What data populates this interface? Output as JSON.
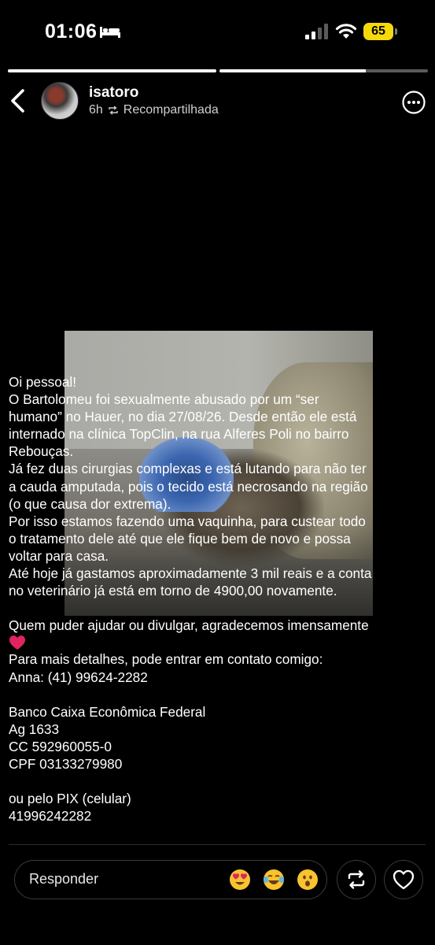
{
  "status_bar": {
    "time": "01:06",
    "battery_level": "65",
    "icons": [
      "bed-icon",
      "signal-icon",
      "wifi-icon",
      "battery-icon"
    ]
  },
  "progress": [
    {
      "fill": 1.0
    },
    {
      "fill": 0.7
    }
  ],
  "story": {
    "username": "isatoro",
    "age": "6h",
    "repost_label": "Recompartilhada",
    "text_lines": [
      "Oi pessoal!",
      "O Bartolomeu foi sexualmente abusado por um “ser",
      "humano” no Hauer, no dia 27/08/26. Desde então ele está",
      "internado na clínica TopClin, na rua Alferes Poli no bairro",
      "Rebouças.",
      "Já fez duas cirurgias complexas e está lutando para não ter",
      "a cauda amputada, pois o tecido está necrosando na região",
      "(o que causa dor extrema).",
      "Por isso estamos fazendo uma vaquinha, para custear todo",
      "o tratamento dele até que ele fique bem de novo e possa",
      "voltar para casa.",
      "Até hoje já gastamos aproximadamente 3 mil reais e a conta",
      "no veterinário já está em torno de 4900,00 novamente."
    ],
    "text_lines_2": [
      "Quem puder ajudar ou divulgar, agradecemos imensamente"
    ],
    "text_lines_3": [
      "Para mais detalhes, pode entrar em contato comigo:",
      "Anna: (41) 99624-2282"
    ],
    "text_lines_4": [
      "Banco Caixa Econômica Federal",
      "Ag 1633",
      "CC 592960055-0",
      "CPF 03133279980"
    ],
    "text_lines_5": [
      "ou pelo PIX (celular)",
      "41996242282"
    ]
  },
  "reply": {
    "placeholder": "Responder",
    "quick_reactions": [
      "heart-eyes-emoji",
      "laughing-tears-emoji",
      "surprised-emoji"
    ]
  },
  "colors": {
    "background": "#000000",
    "battery": "#f5d90a",
    "heart": "#e0245e"
  }
}
